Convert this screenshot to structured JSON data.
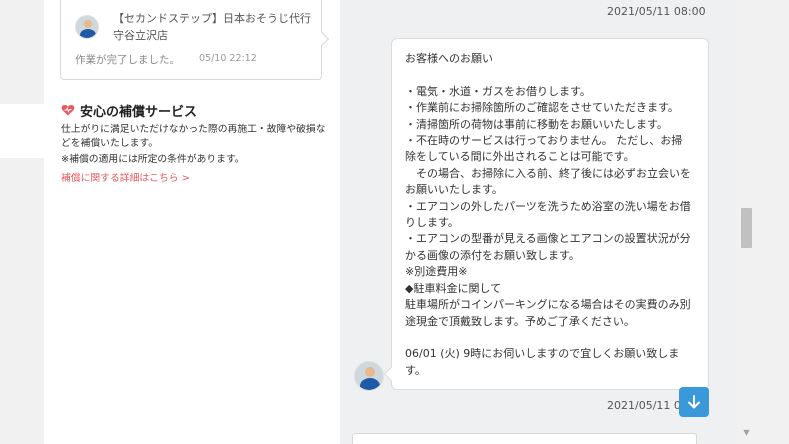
{
  "notification": {
    "title": "【セカンドステップ】日本おそうじ代行守谷立沢店",
    "text": "作業が完了しました。",
    "time": "05/10 22:12"
  },
  "guarantee": {
    "title": "安心の補償サービス",
    "body": "仕上がりに満足いただけなかった際の再施工・故障や破損などを補償いたします。",
    "note": "※補償の適用には所定の条件があります。",
    "link": "補償に関する詳細はこちら >"
  },
  "chat": {
    "time_top": "2021/05/11 08:00",
    "message_lines": [
      "お客様へのお願い",
      "",
      "・電気・水道・ガスをお借りします。",
      "・作業前にお掃除箇所のご確認をさせていただきます。",
      "・清掃箇所の荷物は事前に移動をお願いいたします。",
      "・不在時のサービスは行っておりません。 ただし、お掃",
      "除をしている間に外出されることは可能です。",
      "　その場合、お掃除に入る前、終了後には必ずお立会いを",
      "お願いいたします。",
      "・エアコンの外したパーツを洗うため浴室の洗い場をお借",
      "りします。",
      "・エアコンの型番が見える画像とエアコンの設置状況が分",
      "かる画像の添付をお願い致します。",
      "※別途費用※",
      "◆駐車料金に関して",
      "駐車場所がコインパーキングになる場合はその実費のみ別",
      "途現金で頂戴致します。予めご了承ください。",
      "",
      "06/01 (火) 9時にお伺いしますので宜しくお願い致しま",
      "す。"
    ],
    "time_bottom": "2021/05/11 0"
  },
  "icons": {
    "heart": "heart-icon",
    "scroll_down": "arrow-down-icon"
  },
  "colors": {
    "accent": "#3a9ad9",
    "link": "#e8585c",
    "heart": "#e8585c"
  }
}
